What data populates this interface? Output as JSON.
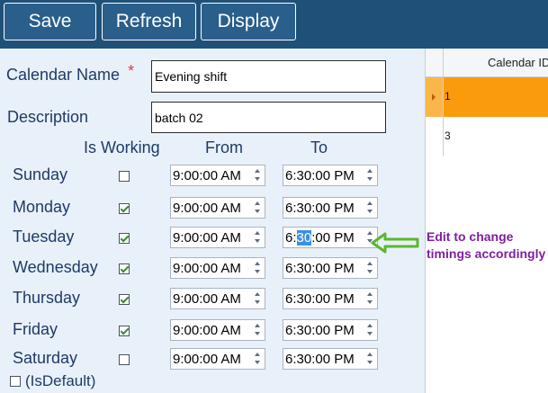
{
  "toolbar": {
    "save_label": "Save",
    "refresh_label": "Refresh",
    "display_label": "Display"
  },
  "form": {
    "calendar_name_label": "Calendar Name",
    "required_marker": "*",
    "calendar_name_value": "Evening shift",
    "description_label": "Description",
    "description_value": "batch 02",
    "col_is_working": "Is Working",
    "col_from": "From",
    "col_to": "To",
    "days": [
      {
        "name": "Sunday",
        "working": false,
        "from": "9:00:00 AM",
        "to": "6:30:00 PM"
      },
      {
        "name": "Monday",
        "working": true,
        "from": "9:00:00 AM",
        "to": "6:30:00 PM"
      },
      {
        "name": "Tuesday",
        "working": true,
        "from": "9:00:00 AM",
        "to": "6:30:00 PM",
        "to_parts": [
          "6:",
          "30",
          ":00 PM"
        ]
      },
      {
        "name": "Wednesday",
        "working": true,
        "from": "9:00:00 AM",
        "to": "6:30:00 PM"
      },
      {
        "name": "Thursday",
        "working": true,
        "from": "9:00:00 AM",
        "to": "6:30:00 PM"
      },
      {
        "name": "Friday",
        "working": true,
        "from": "9:00:00 AM",
        "to": "6:30:00 PM"
      },
      {
        "name": "Saturday",
        "working": false,
        "from": "9:00:00 AM",
        "to": "6:30:00 PM"
      }
    ],
    "is_default_label": "(IsDefault)",
    "is_default_checked": false
  },
  "grid": {
    "header": "Calendar ID",
    "rows": [
      {
        "id": "1",
        "selected": true
      },
      {
        "id": "3",
        "selected": false
      }
    ]
  },
  "annotation": {
    "line1": "Edit to change",
    "line2": "timings accordingly"
  },
  "colors": {
    "toolbar_bg": "#1f5178",
    "form_bg": "#e8f1fa",
    "label_text": "#1f3a66",
    "selected_row": "#f99b0c",
    "annotation_text": "#7f1fa0",
    "arrow": "#5bb82d",
    "check": "#3a8a2e"
  }
}
